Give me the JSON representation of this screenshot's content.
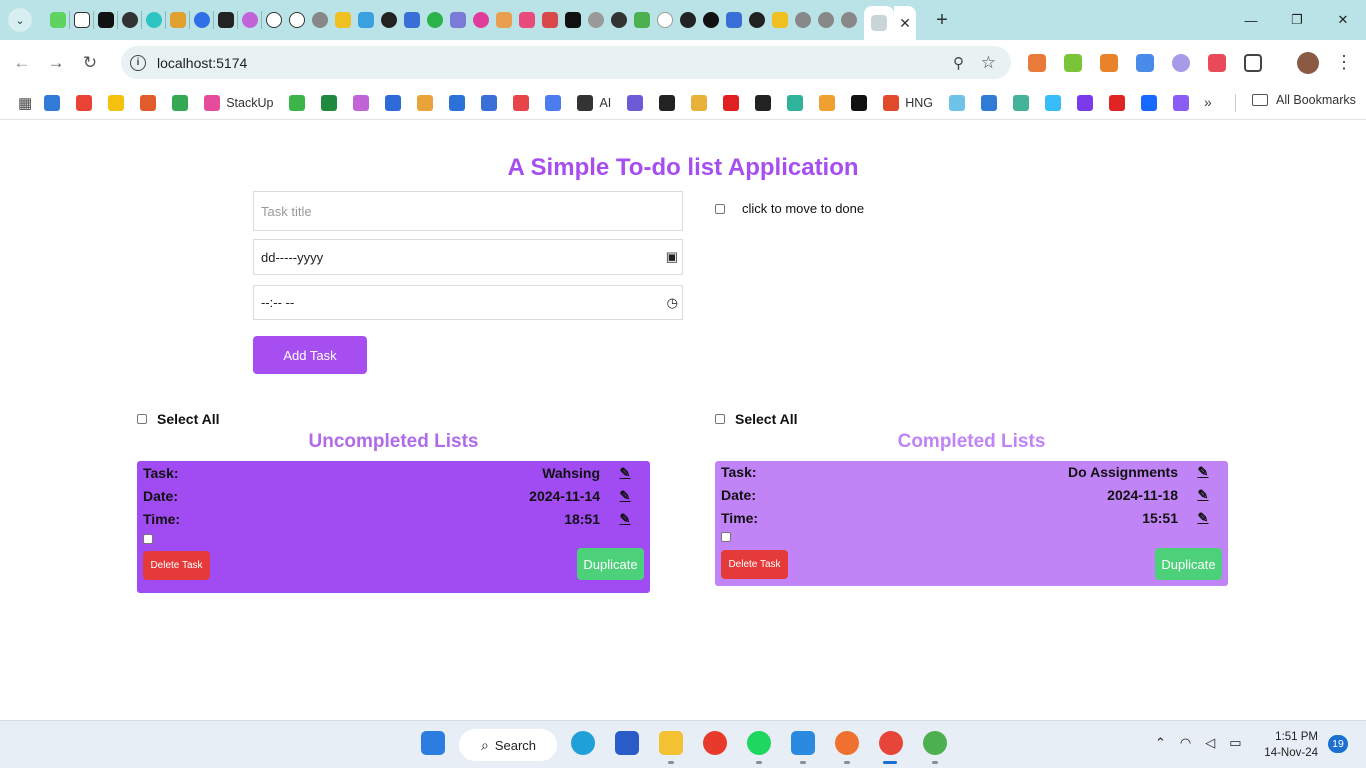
{
  "browser": {
    "url": "localhost:5174",
    "bookmarks": [
      {
        "label": "",
        "color": "#2f7bd6"
      },
      {
        "label": "",
        "color": "#ea4335"
      },
      {
        "label": "",
        "color": "#f4c20d"
      },
      {
        "label": "",
        "color": "#e25b2b"
      },
      {
        "label": "",
        "color": "#34a853"
      },
      {
        "label": "StackUp",
        "color": "#e64c9d"
      },
      {
        "label": "",
        "color": "#3bb54a"
      },
      {
        "label": "",
        "color": "#1f8a3e"
      },
      {
        "label": "",
        "color": "#c064d8"
      },
      {
        "label": "",
        "color": "#2d6ad8"
      },
      {
        "label": "",
        "color": "#e8a33a"
      },
      {
        "label": "",
        "color": "#2a72d8"
      },
      {
        "label": "",
        "color": "#3a6fd8"
      },
      {
        "label": "",
        "color": "#e8454a"
      },
      {
        "label": "",
        "color": "#4d7cf0"
      },
      {
        "label": "AI",
        "color": "#333333"
      },
      {
        "label": "",
        "color": "#6c5bd6"
      },
      {
        "label": "",
        "color": "#222222"
      },
      {
        "label": "",
        "color": "#e8b23a"
      },
      {
        "label": "",
        "color": "#e02020"
      },
      {
        "label": "",
        "color": "#222222"
      },
      {
        "label": "",
        "color": "#2fb39a"
      },
      {
        "label": "",
        "color": "#f0a030"
      },
      {
        "label": "",
        "color": "#111111"
      },
      {
        "label": "HNG",
        "color": "#e04a2a"
      },
      {
        "label": "",
        "color": "#6fc3e8"
      },
      {
        "label": "",
        "color": "#2f7bd6"
      },
      {
        "label": "",
        "color": "#45b39a"
      },
      {
        "label": "",
        "color": "#38bdf8"
      },
      {
        "label": "",
        "color": "#7c3aed"
      },
      {
        "label": "",
        "color": "#e02424"
      },
      {
        "label": "",
        "color": "#1769ff"
      },
      {
        "label": "",
        "color": "#8b5cf6"
      }
    ],
    "more_symbol": "»",
    "all_bookmarks": "All Bookmarks"
  },
  "app": {
    "title": "A Simple To-do list Application",
    "task_title_placeholder": "Task title",
    "date_placeholder": "dd-----yyyy",
    "time_placeholder": "--:-- --",
    "add_button": "Add Task",
    "move_label": "click to move to done"
  },
  "uncompleted": {
    "select_all": "Select All",
    "heading": "Uncompleted Lists",
    "heading_color": "#b06be8",
    "card_color": "#a04cf2",
    "task_label": "Task:",
    "task_value": "Wahsing",
    "date_label": "Date:",
    "date_value": "2024-11-14",
    "time_label": "Time:",
    "time_value": "18:51",
    "delete_button": "Delete Task",
    "duplicate_button": "Duplicate"
  },
  "completed": {
    "select_all": "Select All",
    "heading": "Completed Lists",
    "heading_color": "#c084f5",
    "card_color": "#c184f7",
    "task_label": "Task:",
    "task_value": "Do Assignments",
    "date_label": "Date:",
    "date_value": "2024-11-18",
    "time_label": "Time:",
    "time_value": "15:51",
    "delete_button": "Delete Task",
    "duplicate_button": "Duplicate"
  },
  "taskbar": {
    "search_label": "Search",
    "time": "1:51 PM",
    "date": "14-Nov-24",
    "notifications": "19"
  }
}
